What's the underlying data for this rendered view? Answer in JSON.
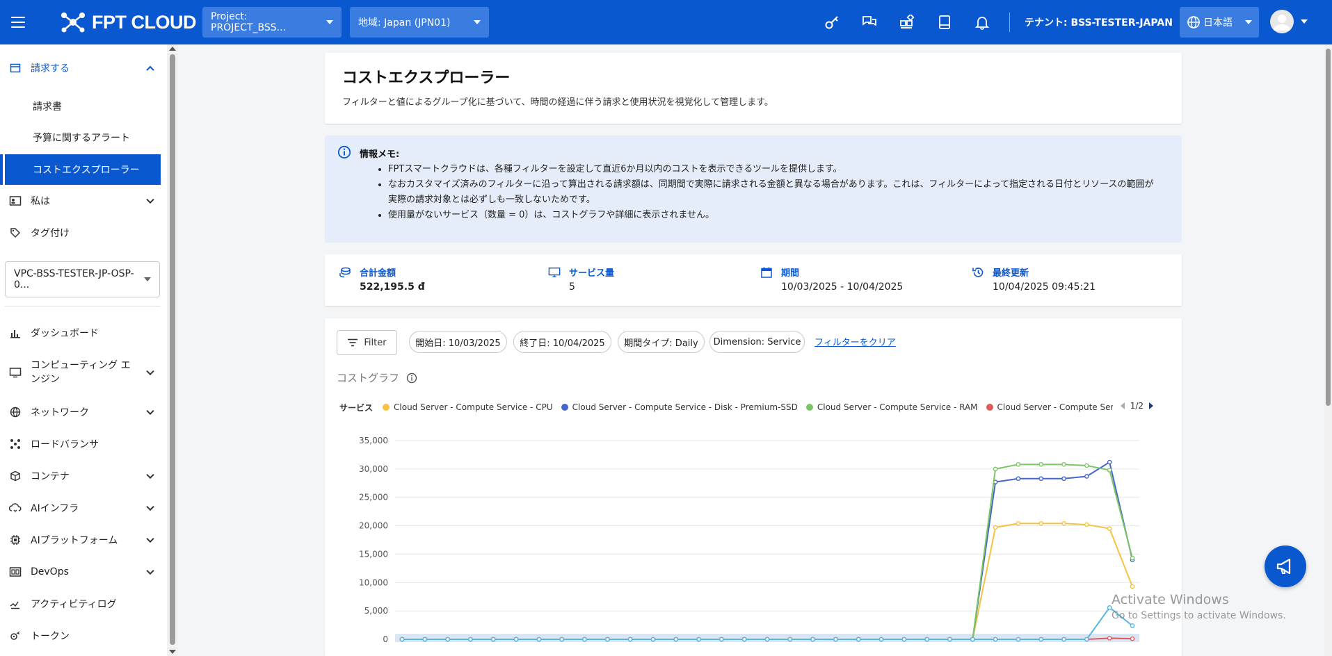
{
  "header": {
    "logo_text": "FPT CLOUD",
    "project_select": "Project: PROJECT_BSS...",
    "region_select": "地域: Japan (JPN01)",
    "tenant": "テナント: BSS-TESTER-JAPAN",
    "language": "日本語"
  },
  "sidebar": {
    "billing": "請求する",
    "invoices": "請求書",
    "budget_alerts": "予算に関するアラート",
    "cost_explorer": "コストエクスプローラー",
    "me": "私は",
    "tagging": "タグ付け",
    "vpc_select": "VPC-BSS-TESTER-JP-OSP-0...",
    "dashboard": "ダッシュボード",
    "compute_engine": "コンピューティング エンジン",
    "network": "ネットワーク",
    "load_balancer": "ロードバランサ",
    "container": "コンテナ",
    "ai_infra": "AIインフラ",
    "ai_platform": "AIプラットフォーム",
    "devops": "DevOps",
    "activity_log": "アクティビティログ",
    "token": "トークン"
  },
  "page": {
    "title": "コストエクスプローラー",
    "subtitle": "フィルターと値によるグループ化に基づいて、時間の経過に伴う請求と使用状況を視覚化して管理します。"
  },
  "info": {
    "title": "情報メモ:",
    "items": [
      "FPTスマートクラウドは、各種フィルターを設定して直近6か月以内のコストを表示できるツールを提供します。",
      "なおカスタマイズ済みのフィルターに沿って算出される請求額は、同期間で実際に請求される金額と異なる場合があります。これは、フィルターによって指定される日付とリソースの範囲が実際の請求対象とは必ずしも一致しないためです。",
      "使用量がないサービス（数量 = 0）は、コストグラフや詳細に表示されません。"
    ]
  },
  "stats": {
    "total_label": "合計金額",
    "total_value": "522,195.5 đ",
    "services_label": "サービス量",
    "services_value": "5",
    "period_label": "期間",
    "period_value": "10/03/2025 - 10/04/2025",
    "updated_label": "最終更新",
    "updated_value": "10/04/2025 09:45:21"
  },
  "filters": {
    "filter_button": "Filter",
    "start": "開始日: 10/03/2025",
    "end": "終了日: 10/04/2025",
    "period_type": "期間タイプ: Daily",
    "dimension": "Dimension: Service",
    "clear": "フィルターをクリア"
  },
  "chart_section": {
    "label": "コストグラフ"
  },
  "watermark": {
    "line1": "Activate Windows",
    "line2": "Go to Settings to activate Windows."
  },
  "chart_data": {
    "type": "line",
    "legend_title": "サービス",
    "legend_page": "1/2",
    "ylim": [
      0,
      35000
    ],
    "yticks": [
      "0",
      "5,000",
      "10,000",
      "15,000",
      "20,000",
      "25,000",
      "30,000",
      "35,000"
    ],
    "point_count": 33,
    "series": [
      {
        "name": "Cloud Server - Compute Service - CPU",
        "color": "#f5c242",
        "values": [
          0,
          0,
          0,
          0,
          0,
          0,
          0,
          0,
          0,
          0,
          0,
          0,
          0,
          0,
          0,
          0,
          0,
          0,
          0,
          0,
          0,
          0,
          0,
          0,
          0,
          0,
          19700,
          20400,
          20400,
          20400,
          20200,
          19500,
          9300
        ]
      },
      {
        "name": "Cloud Server - Compute Service - Disk - Premium-SSD",
        "color": "#4466cc",
        "values": [
          0,
          0,
          0,
          0,
          0,
          0,
          0,
          0,
          0,
          0,
          0,
          0,
          0,
          0,
          0,
          0,
          0,
          0,
          0,
          0,
          0,
          0,
          0,
          0,
          0,
          0,
          27700,
          28300,
          28300,
          28300,
          28700,
          31200,
          14000
        ]
      },
      {
        "name": "Cloud Server - Compute Service - RAM",
        "color": "#7cc566",
        "values": [
          0,
          0,
          0,
          0,
          0,
          0,
          0,
          0,
          0,
          0,
          0,
          0,
          0,
          0,
          0,
          0,
          0,
          0,
          0,
          0,
          0,
          0,
          0,
          0,
          0,
          0,
          30000,
          30800,
          30800,
          30800,
          30600,
          29800,
          14300
        ]
      },
      {
        "name": "Cloud Server - Compute Service - Di",
        "color": "#e05a5a",
        "values": [
          0,
          0,
          0,
          0,
          0,
          0,
          0,
          0,
          0,
          0,
          0,
          0,
          0,
          0,
          0,
          0,
          0,
          0,
          0,
          0,
          0,
          0,
          0,
          0,
          0,
          0,
          0,
          0,
          0,
          0,
          0,
          200,
          100
        ]
      },
      {
        "name": "",
        "color": "#5ab4e0",
        "values": [
          0,
          0,
          0,
          0,
          0,
          0,
          0,
          0,
          0,
          0,
          0,
          0,
          0,
          0,
          0,
          0,
          0,
          0,
          0,
          0,
          0,
          0,
          0,
          0,
          0,
          0,
          0,
          0,
          0,
          0,
          0,
          5600,
          2400
        ]
      }
    ]
  }
}
